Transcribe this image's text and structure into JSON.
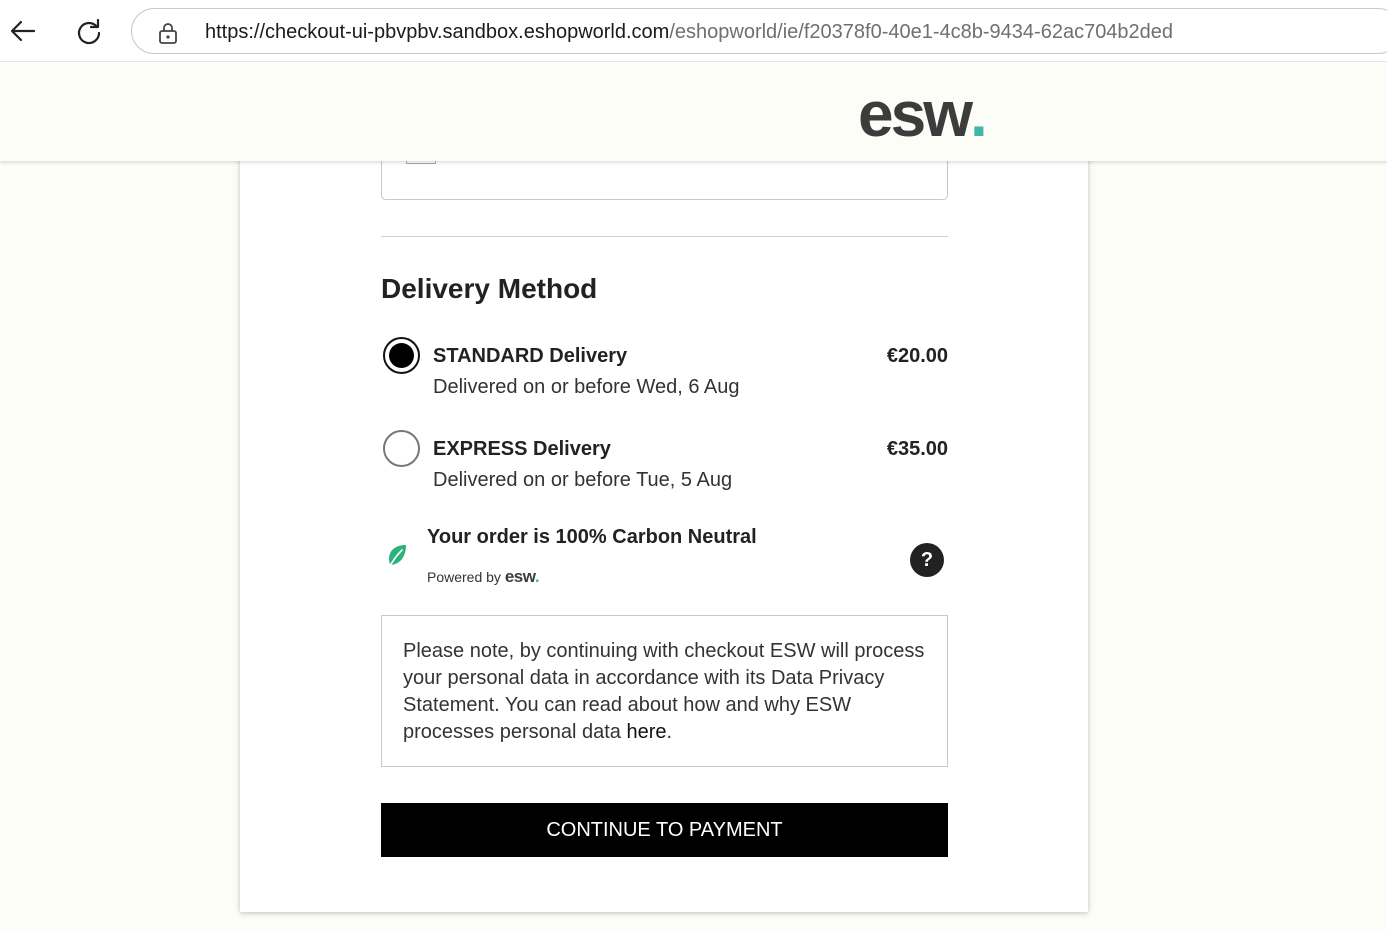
{
  "browser": {
    "url_host": "https://checkout-ui-pbvpbv.sandbox.eshopworld.com",
    "url_path": "/eshopworld/ie/f20378f0-40e1-4c8b-9434-62ac704b2ded"
  },
  "header": {
    "logo_text": "esw",
    "logo_dot": "."
  },
  "delivery": {
    "title": "Delivery Method",
    "options": [
      {
        "name": "STANDARD Delivery",
        "date": "Delivered on or before Wed, 6 Aug",
        "price": "€20.00",
        "selected": true
      },
      {
        "name": "EXPRESS Delivery",
        "date": "Delivered on or before Tue, 5 Aug",
        "price": "€35.00",
        "selected": false
      }
    ]
  },
  "carbon": {
    "title": "Your order is 100% Carbon Neutral",
    "powered_by": "Powered by",
    "powered_logo": "esw",
    "powered_dot": ".",
    "help_label": "?"
  },
  "notice": {
    "text": "Please note, by continuing with checkout ESW will process your personal data in accordance with its Data Privacy Statement. You can read about how and why ESW processes personal data ",
    "link_text": "here",
    "suffix": "."
  },
  "actions": {
    "continue_label": "CONTINUE TO PAYMENT"
  },
  "colors": {
    "brand_accent": "#3fb8a8",
    "button_bg": "#000000",
    "page_bg": "#fdfdf8"
  }
}
